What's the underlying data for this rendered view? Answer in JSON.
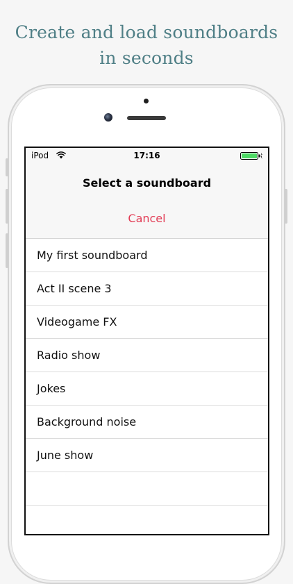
{
  "headline": {
    "line1": "Create and load soundboards",
    "line2": "in seconds"
  },
  "status_bar": {
    "carrier": "iPod",
    "wifi_icon": "wifi-icon",
    "time": "17:16",
    "battery_icon": "battery-icon",
    "battery_color": "#4cd964"
  },
  "sheet": {
    "title": "Select a soundboard",
    "cancel_label": "Cancel",
    "cancel_color": "#e23c55"
  },
  "soundboards": [
    "My first soundboard",
    "Act II scene 3",
    "Videogame FX",
    "Radio show",
    "Jokes",
    "Background noise",
    "June show"
  ]
}
